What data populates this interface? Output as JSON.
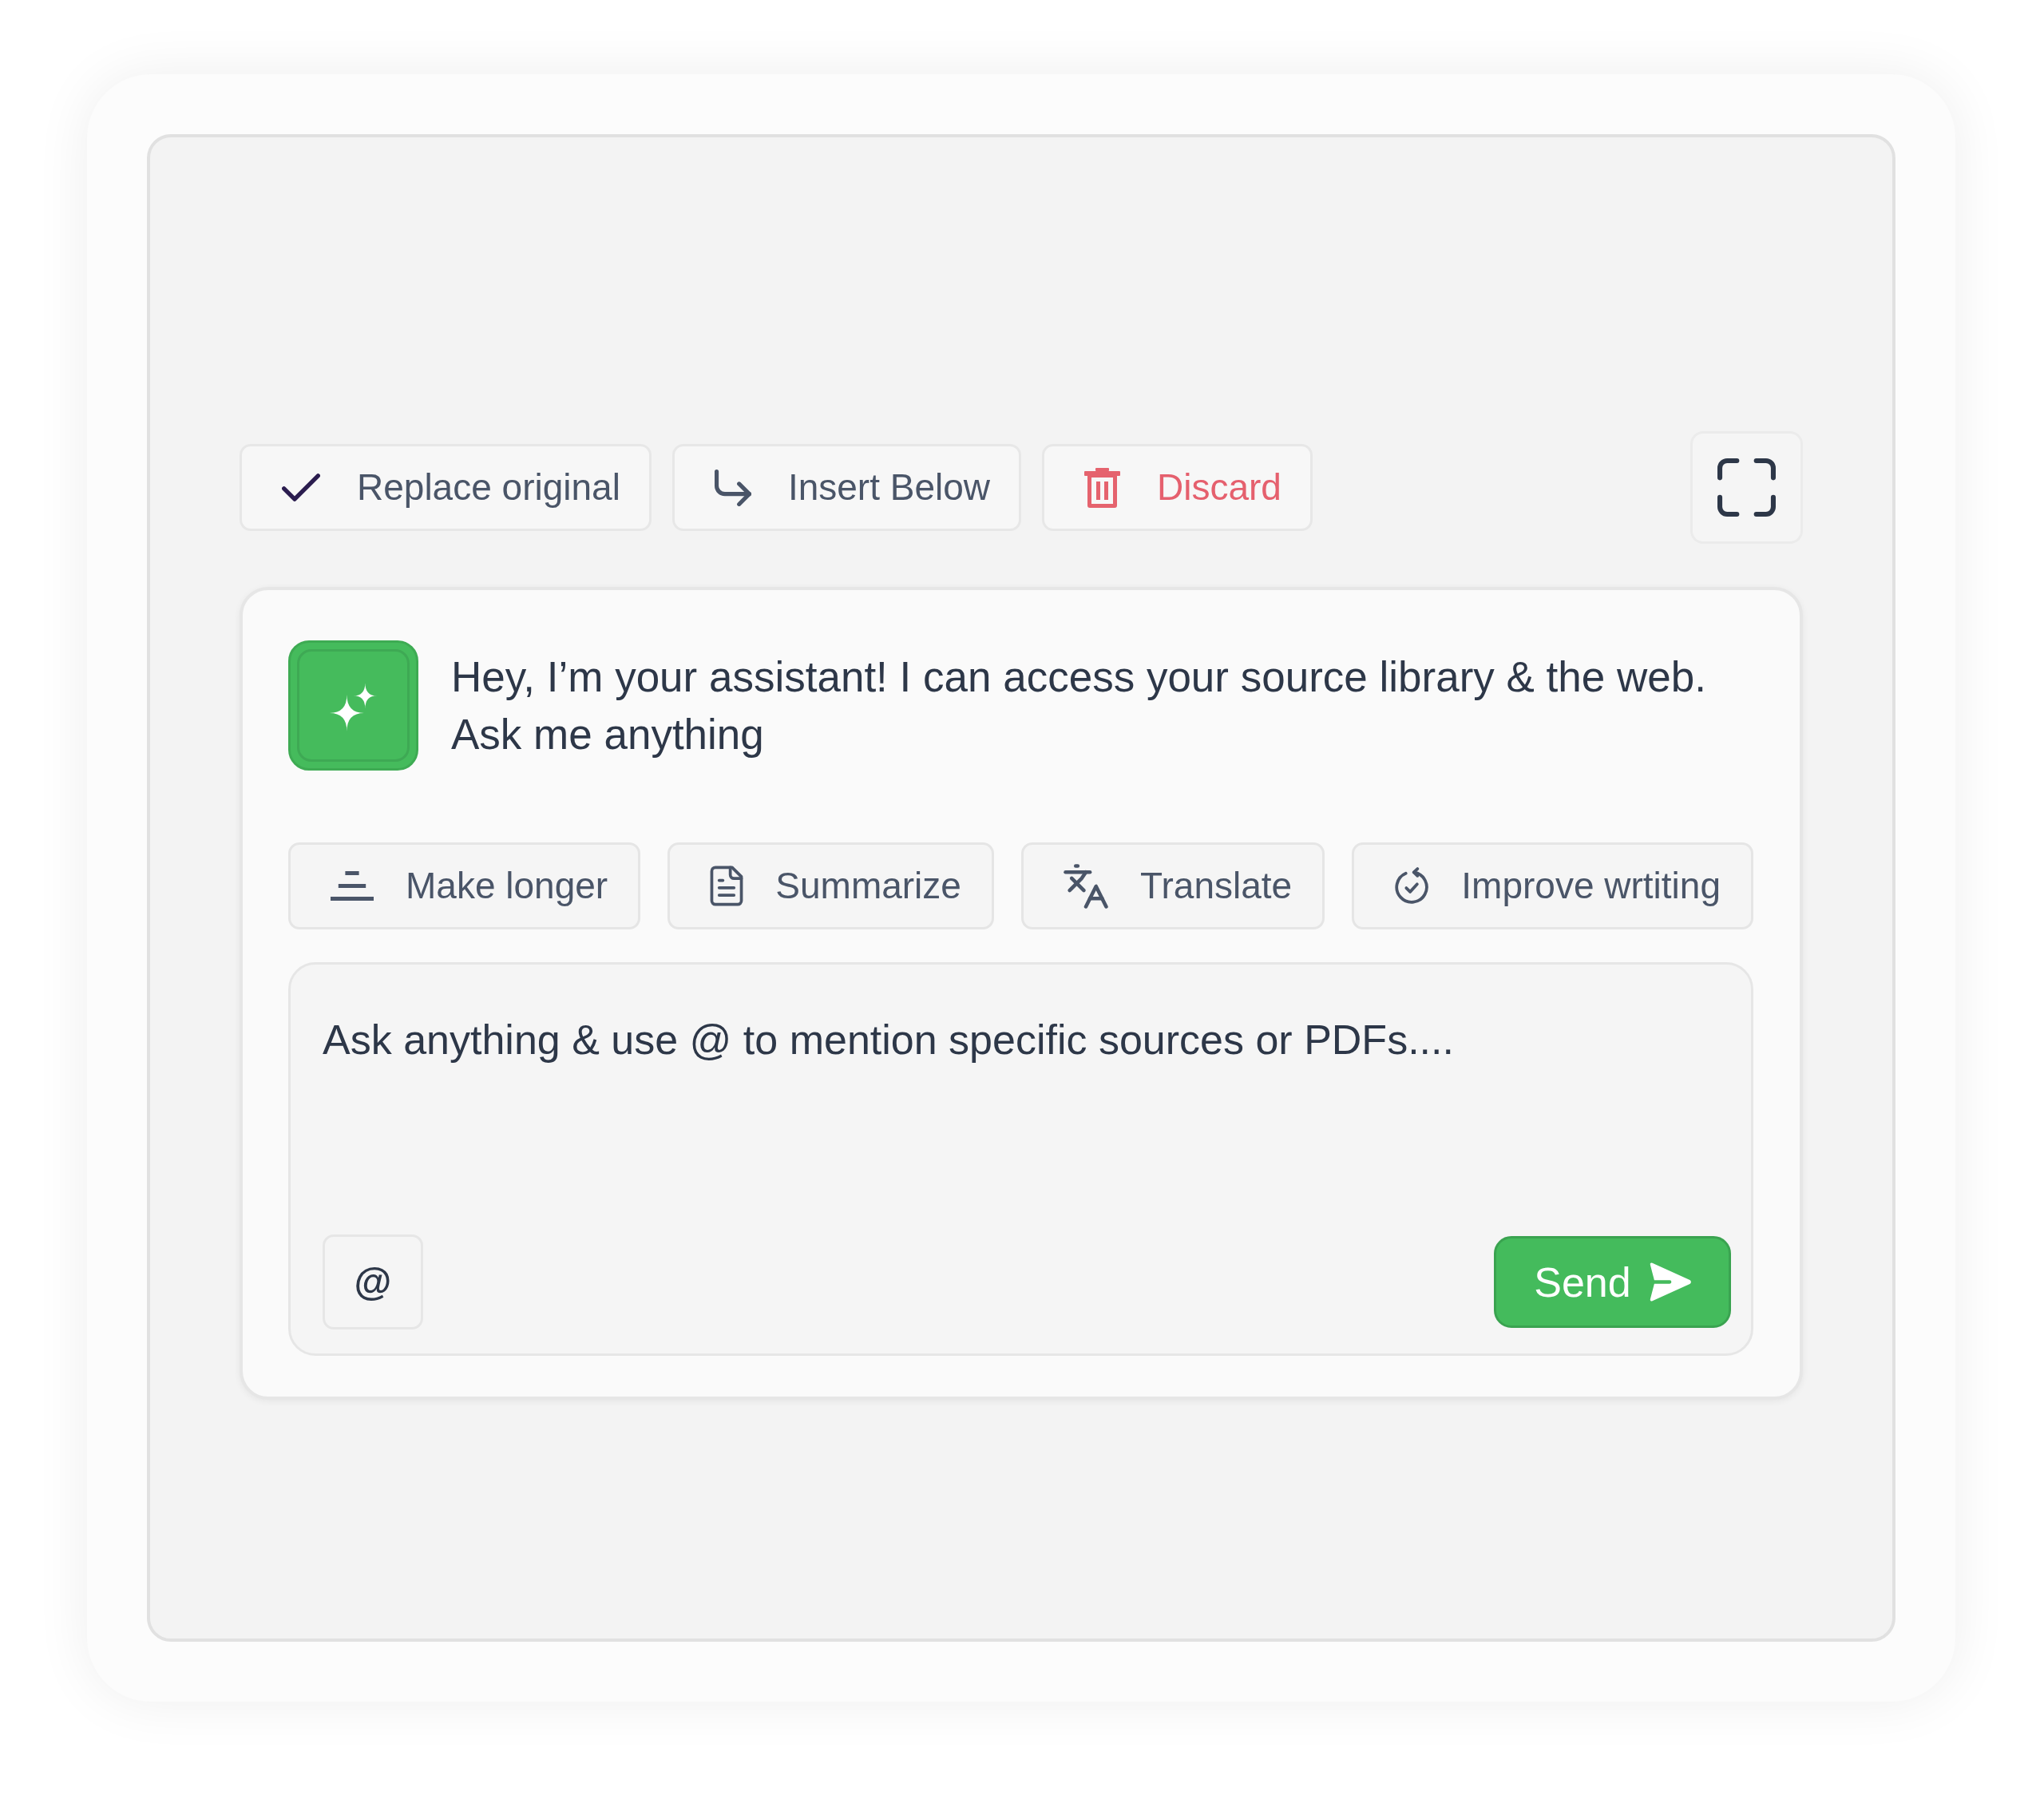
{
  "toolbar": {
    "actions": [
      {
        "kind": "accept",
        "label": "Replace original"
      },
      {
        "kind": "insert",
        "label": "Insert Below"
      },
      {
        "kind": "discard",
        "label": "Discard"
      }
    ]
  },
  "assistant": {
    "message": "Hey, I’m your assistant! I can access your source library & the web. Ask me anything"
  },
  "quick_actions": [
    {
      "kind": "longer",
      "label": "Make longer"
    },
    {
      "kind": "summarize",
      "label": "Summarize"
    },
    {
      "kind": "translate",
      "label": "Translate"
    },
    {
      "kind": "improve",
      "label": "Improve wrtiting"
    }
  ],
  "composer": {
    "placeholder": "Ask anything & use @ to mention specific sources or PDFs....",
    "mention_button": "@",
    "send_button": "Send"
  }
}
